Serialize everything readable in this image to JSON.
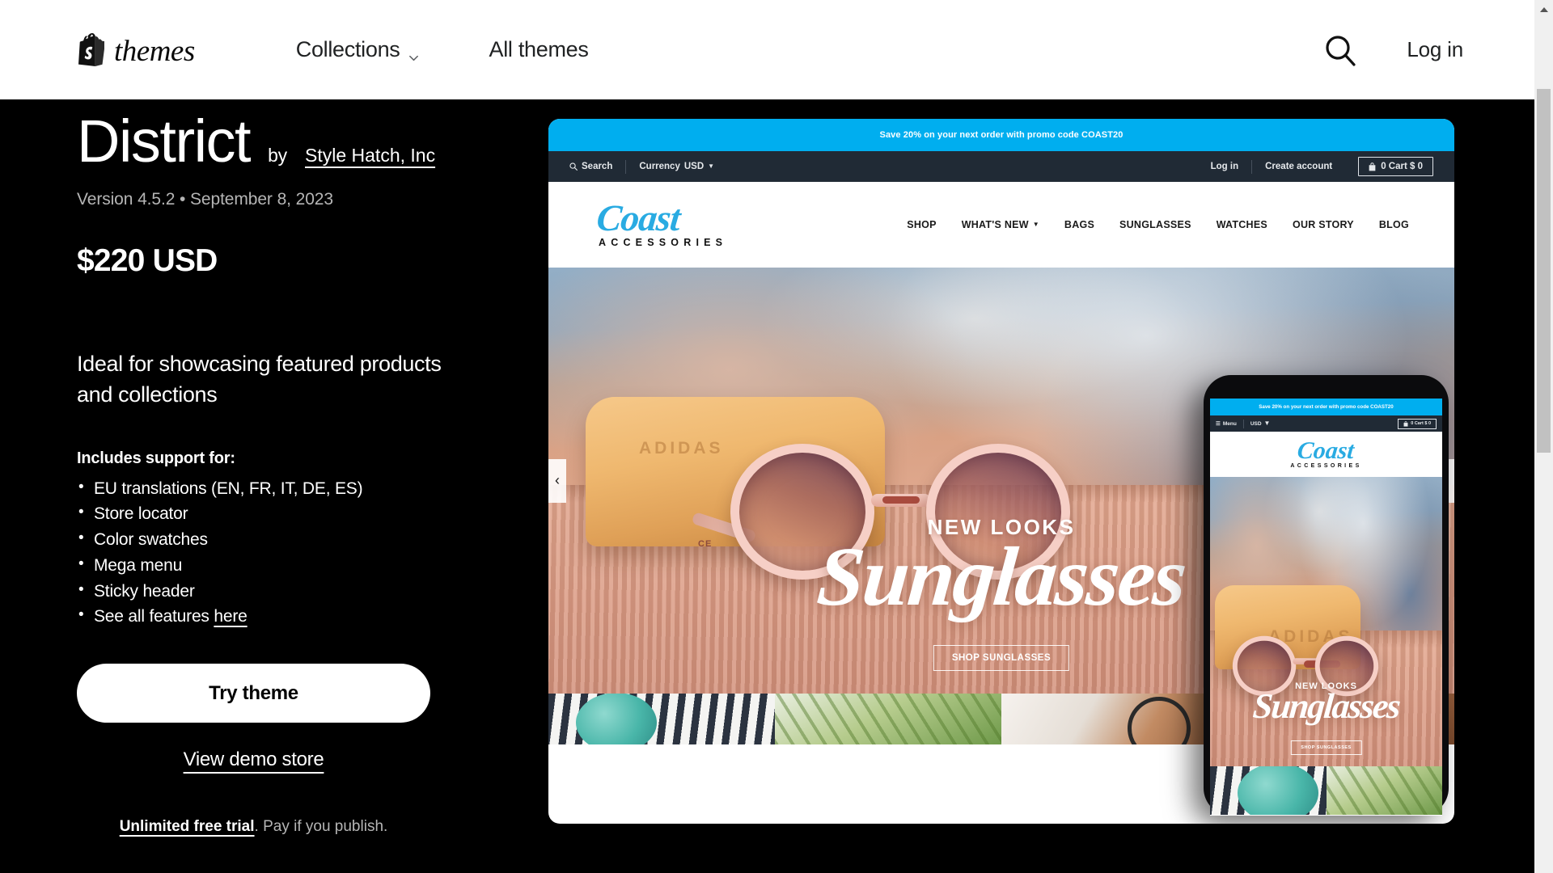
{
  "header": {
    "brand": "themes",
    "logo_icon": "shopify-bag-icon",
    "nav": [
      {
        "label": "Collections",
        "has_dropdown": true
      },
      {
        "label": "All themes",
        "has_dropdown": false
      }
    ],
    "search_icon": "search-icon",
    "login_label": "Log in"
  },
  "theme": {
    "name": "District",
    "by_prefix": "by",
    "author": "Style Hatch, Inc",
    "version_line": "Version 4.5.2 • September 8, 2023",
    "price": "$220 USD",
    "tagline": "Ideal for showcasing featured products and collections",
    "includes_heading": "Includes support for:",
    "features": [
      "EU translations (EN, FR, IT, DE, ES)",
      "Store locator",
      "Color swatches",
      "Mega menu",
      "Sticky header"
    ],
    "see_all_prefix": "See all features",
    "see_all_link": "here",
    "try_button": "Try theme",
    "demo_link": "View demo store",
    "trial_bold": "Unlimited free trial",
    "trial_rest": ". Pay if you publish."
  },
  "preview": {
    "promo_banner": "Save 20% on your next order with promo code COAST20",
    "utility": {
      "search_icon": "search-icon",
      "search_label": "Search",
      "currency_label": "Currency",
      "currency_value": "USD",
      "login": "Log in",
      "create_account": "Create account",
      "cart_icon": "shopping-bag-icon",
      "cart_label": "0 Cart $ 0"
    },
    "store_logo": {
      "word": "Coast",
      "subtitle": "ACCESSORIES"
    },
    "store_nav": [
      "SHOP",
      "WHAT'S NEW",
      "BAGS",
      "SUNGLASSES",
      "WATCHES",
      "OUR STORY",
      "BLOG"
    ],
    "hero": {
      "eyebrow": "NEW LOOKS",
      "headline": "Sunglasses",
      "cta": "SHOP SUNGLASSES",
      "prev_arrow": "‹",
      "next_arrow": "›"
    },
    "phone": {
      "menu_label": "Menu",
      "currency_value": "USD",
      "cart_label": "0 Cart $ 0"
    }
  },
  "colors": {
    "promo_blue": "#00AEEF",
    "utility_dark": "#202A35",
    "logo_blue": "#29ABE2",
    "page_background": "#000000"
  },
  "scrollbar": {
    "up_arrow_icon": "triangle-up-icon"
  }
}
